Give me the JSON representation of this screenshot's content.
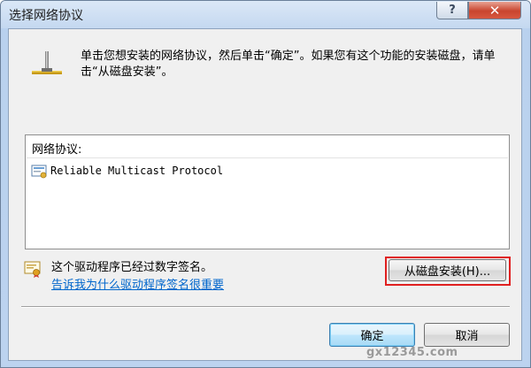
{
  "window": {
    "title": "选择网络协议",
    "help_label": "?",
    "close_label": "✕"
  },
  "instructions": "单击您想安装的网络协议，然后单击“确定”。如果您有这个功能的安装磁盘，请单击“从磁盘安装”。",
  "protocol_list": {
    "header": "网络协议:",
    "items": [
      {
        "label": "Reliable Multicast Protocol",
        "icon": "network-protocol-icon"
      }
    ]
  },
  "driver_signature": {
    "status_text": "这个驱动程序已经过数字签名。",
    "link_text": "告诉我为什么驱动程序签名很重要",
    "icon": "certificate-icon"
  },
  "buttons": {
    "have_disk": "从磁盘安装(H)...",
    "ok": "确定",
    "cancel": "取消"
  },
  "watermark": "gx12345.com",
  "colors": {
    "link": "#0066cc",
    "highlight_box": "#e02020",
    "close_button": "#c9452e"
  }
}
